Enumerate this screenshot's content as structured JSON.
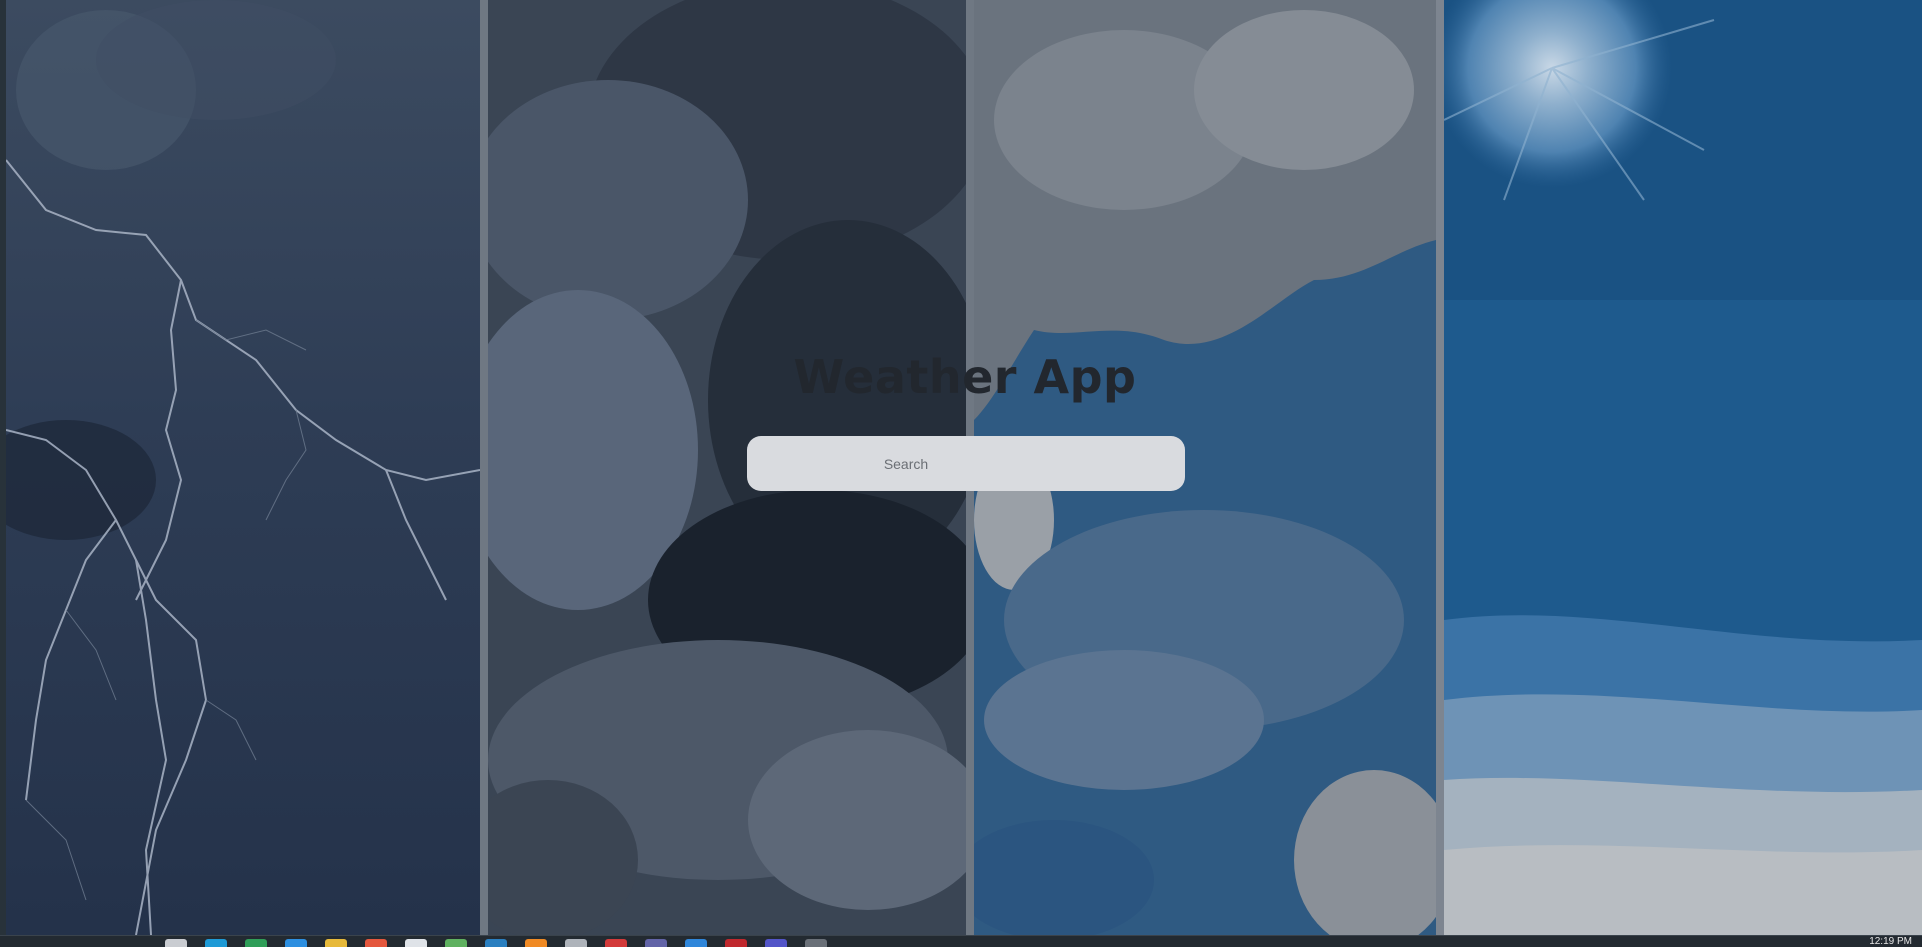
{
  "app": {
    "title": "Weather App",
    "search": {
      "placeholder": "Search",
      "value": ""
    }
  },
  "backgrounds": [
    {
      "name": "lightning-storm",
      "color": "#2b3a50"
    },
    {
      "name": "dark-storm-clouds",
      "color": "#343e4c"
    },
    {
      "name": "cloudy-sky",
      "color": "#345b80"
    },
    {
      "name": "sunny-sky",
      "color": "#1f5a8c"
    }
  ],
  "taskbar": {
    "clock": "12:19 PM",
    "apps": [
      {
        "name": "file-explorer-icon",
        "color": "#c9ccd1"
      },
      {
        "name": "edge-browser-icon",
        "color": "#1e9ad6"
      },
      {
        "name": "spreadsheet-icon",
        "color": "#2f9e58"
      },
      {
        "name": "vscode-icon",
        "color": "#2d8fe0"
      },
      {
        "name": "folder-icon",
        "color": "#e7b93a"
      },
      {
        "name": "git-icon",
        "color": "#e4573d"
      },
      {
        "name": "notepad-icon",
        "color": "#dfe3e8"
      },
      {
        "name": "sheets-icon",
        "color": "#5fb160"
      },
      {
        "name": "terminal-icon",
        "color": "#2a7fc0"
      },
      {
        "name": "firefox-icon",
        "color": "#f08a24"
      },
      {
        "name": "document-icon",
        "color": "#aeb3ba"
      },
      {
        "name": "record-icon",
        "color": "#d33a3a"
      },
      {
        "name": "teams-icon",
        "color": "#6264a7"
      },
      {
        "name": "vs-icon",
        "color": "#2f86da"
      },
      {
        "name": "media-icon",
        "color": "#c0282d"
      },
      {
        "name": "calendar-icon",
        "color": "#5355c8"
      },
      {
        "name": "window-icon",
        "color": "#6a7078"
      }
    ]
  }
}
